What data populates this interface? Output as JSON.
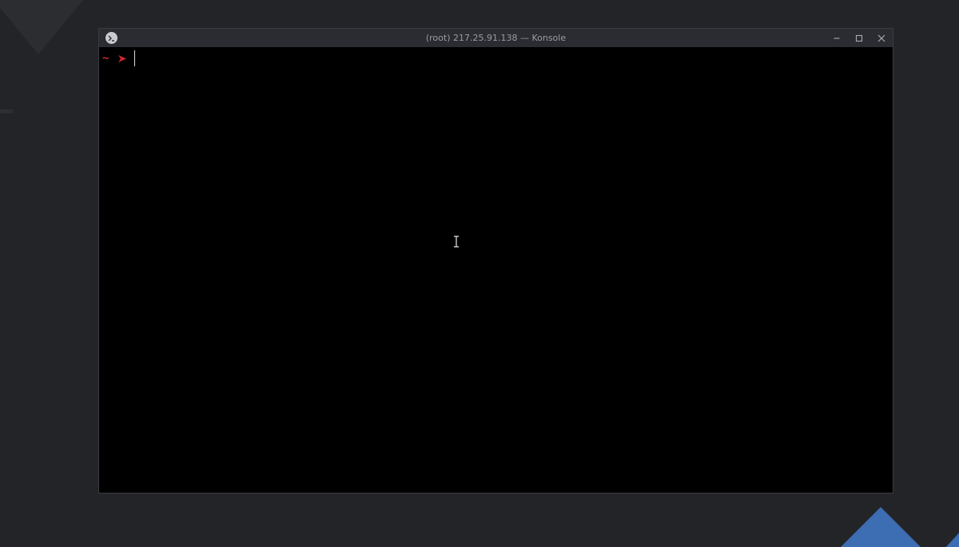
{
  "window": {
    "title": "(root) 217.25.91.138 — Konsole",
    "icon": "terminal-app-icon",
    "controls": [
      "minimize-icon",
      "maximize-icon",
      "close-icon"
    ]
  },
  "terminal": {
    "prompt_dir": "~",
    "prompt_symbol": "arrow-right-icon",
    "input_value": ""
  },
  "colors": {
    "desktop_bg": "#232428",
    "titlebar_bg": "#2a2c31",
    "terminal_bg": "#000000",
    "prompt_color": "#d12b2b",
    "accent_blue": "#3d6db3"
  }
}
